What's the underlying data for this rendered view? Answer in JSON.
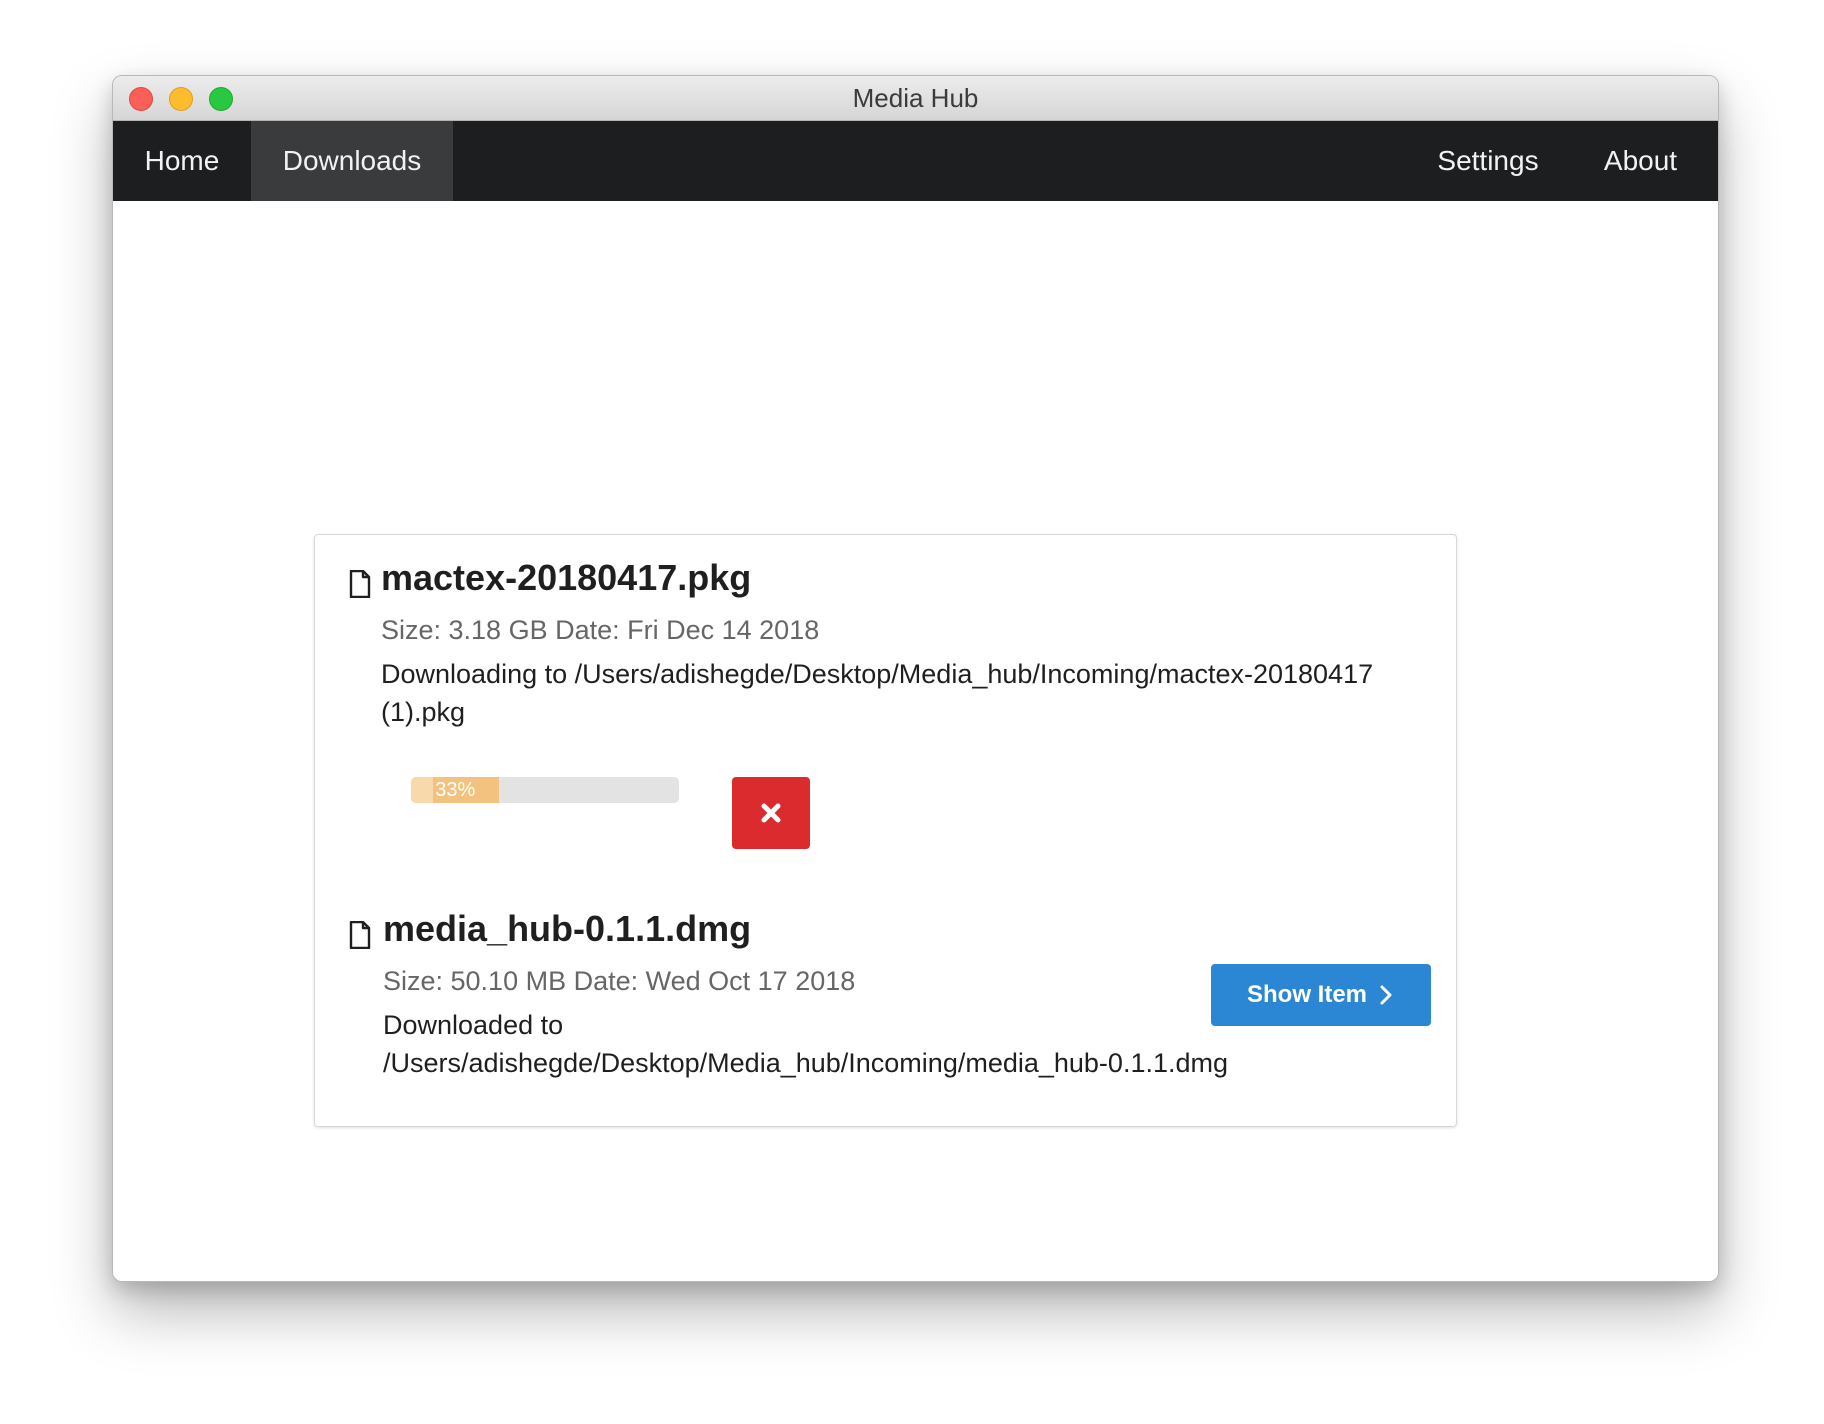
{
  "window": {
    "title": "Media Hub"
  },
  "nav": {
    "home": "Home",
    "downloads": "Downloads",
    "settings": "Settings",
    "about": "About",
    "active": "Downloads"
  },
  "downloads": [
    {
      "name": "mactex-20180417.pkg",
      "meta": "Size: 3.18 GB Date: Fri Dec 14 2018",
      "path": "Downloading to /Users/adishegde/Desktop/Media_hub/Incoming/mactex-20180417 (1).pkg",
      "progress_label": "33%",
      "progress": 0.33,
      "status": "downloading",
      "icon": "file-icon",
      "action_icon": "close-icon"
    },
    {
      "name": "media_hub-0.1.1.dmg",
      "meta": "Size: 50.10 MB Date: Wed Oct 17 2018",
      "path": "Downloaded to /Users/adishegde/Desktop/Media_hub/Incoming/media_hub-0.1.1.dmg",
      "status": "downloaded",
      "icon": "file-icon",
      "action_label": "Show Item",
      "action_icon": "chevron-right-icon"
    }
  ],
  "colors": {
    "navbar": "#1d1e20",
    "nav_active": "#3a3b3d",
    "progress_fill": "#f2c27e",
    "cancel_button": "#dc2b2f",
    "show_button": "#2b87d3"
  }
}
